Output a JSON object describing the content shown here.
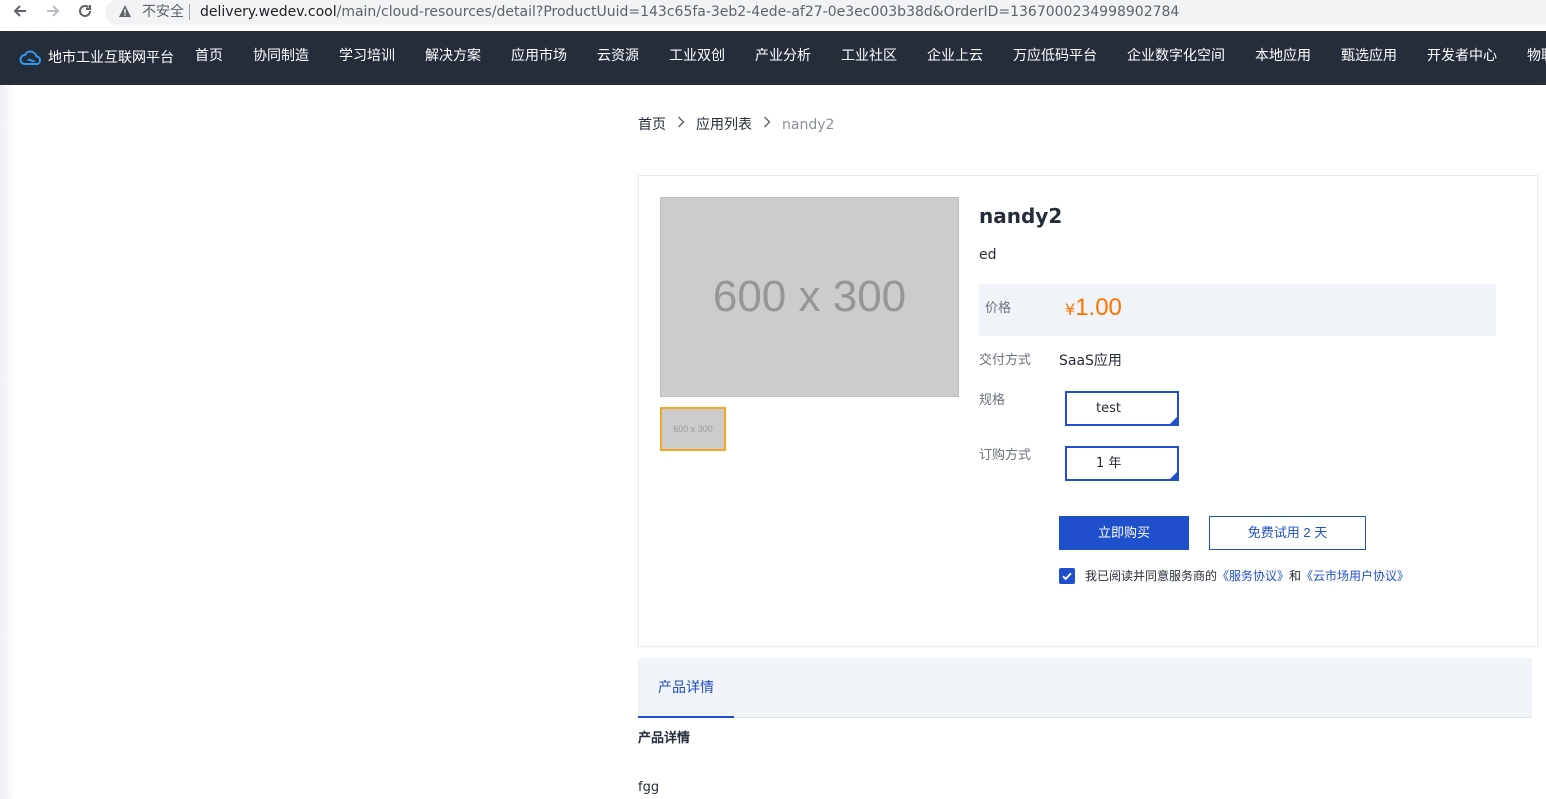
{
  "browser": {
    "insecure_label": "不安全",
    "url_host": "delivery.wedev.cool",
    "url_path": "/main/cloud-resources/detail?ProductUuid=143c65fa-3eb2-4ede-af27-0e3ec003b38d&OrderID=1367000234998902784"
  },
  "header": {
    "platform_name": "地市工业互联网平台",
    "menu": [
      "首页",
      "协同制造",
      "学习培训",
      "解决方案",
      "应用市场",
      "云资源",
      "工业双创",
      "产业分析",
      "工业社区",
      "企业上云",
      "万应低码平台",
      "企业数字化空间",
      "本地应用",
      "甄选应用",
      "开发者中心",
      "物联"
    ]
  },
  "breadcrumb": {
    "home": "首页",
    "list": "应用列表",
    "current": "nandy2"
  },
  "product": {
    "image_placeholder": "600 x 300",
    "thumb_placeholder": "600 x 300",
    "title": "nandy2",
    "description": "ed",
    "price_label": "价格",
    "currency_symbol": "¥",
    "price": "1.00",
    "delivery_label": "交付方式",
    "delivery_value": "SaaS应用",
    "spec_label": "规格",
    "spec_value": "test",
    "order_label": "订购方式",
    "order_value": "1 年",
    "buy_label": "立即购买",
    "trial_label": "免费试用 2 天",
    "agree_text": "我已阅读并同意服务商的",
    "service_link": "《服务协议》",
    "agree_and": "和",
    "market_link": "《云市场用户协议》",
    "agree_checked": true
  },
  "details": {
    "tab_label": "产品详情",
    "heading": "产品详情",
    "body": "fgg"
  },
  "colors": {
    "nav_bg": "#262d3a",
    "accent": "#1f4fcb",
    "price": "#ff7200",
    "thumb_border": "#f5a623"
  }
}
